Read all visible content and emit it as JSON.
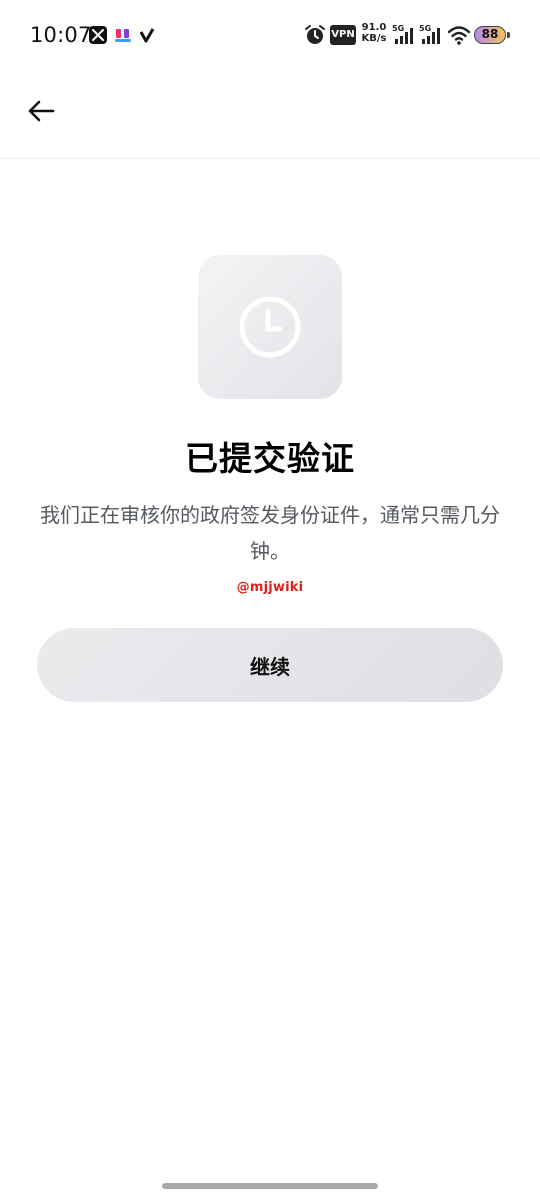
{
  "status_bar": {
    "time": "10:07",
    "notifications": [
      "x-icon",
      "app-icon",
      "v-icon"
    ],
    "vpn_label": "VPN",
    "network_speed": "91.0",
    "network_speed_unit": "KB/s",
    "signal_1_label": "5G",
    "signal_2_label": "5G",
    "battery_level": "88",
    "colors": {
      "battery_start": "#b688f0",
      "battery_end": "#f1c35c"
    }
  },
  "header": {
    "back_icon": "arrow-left-icon"
  },
  "main": {
    "status_icon": "clock-icon",
    "title": "已提交验证",
    "description": "我们正在审核你的政府签发身份证件，通常只需几分钟。",
    "watermark": "@mjjwiki",
    "continue_label": "继续"
  },
  "colors": {
    "title": "#000000",
    "description": "#555a61",
    "button_bg": "#e4e5e8",
    "watermark": "#e0201a"
  }
}
